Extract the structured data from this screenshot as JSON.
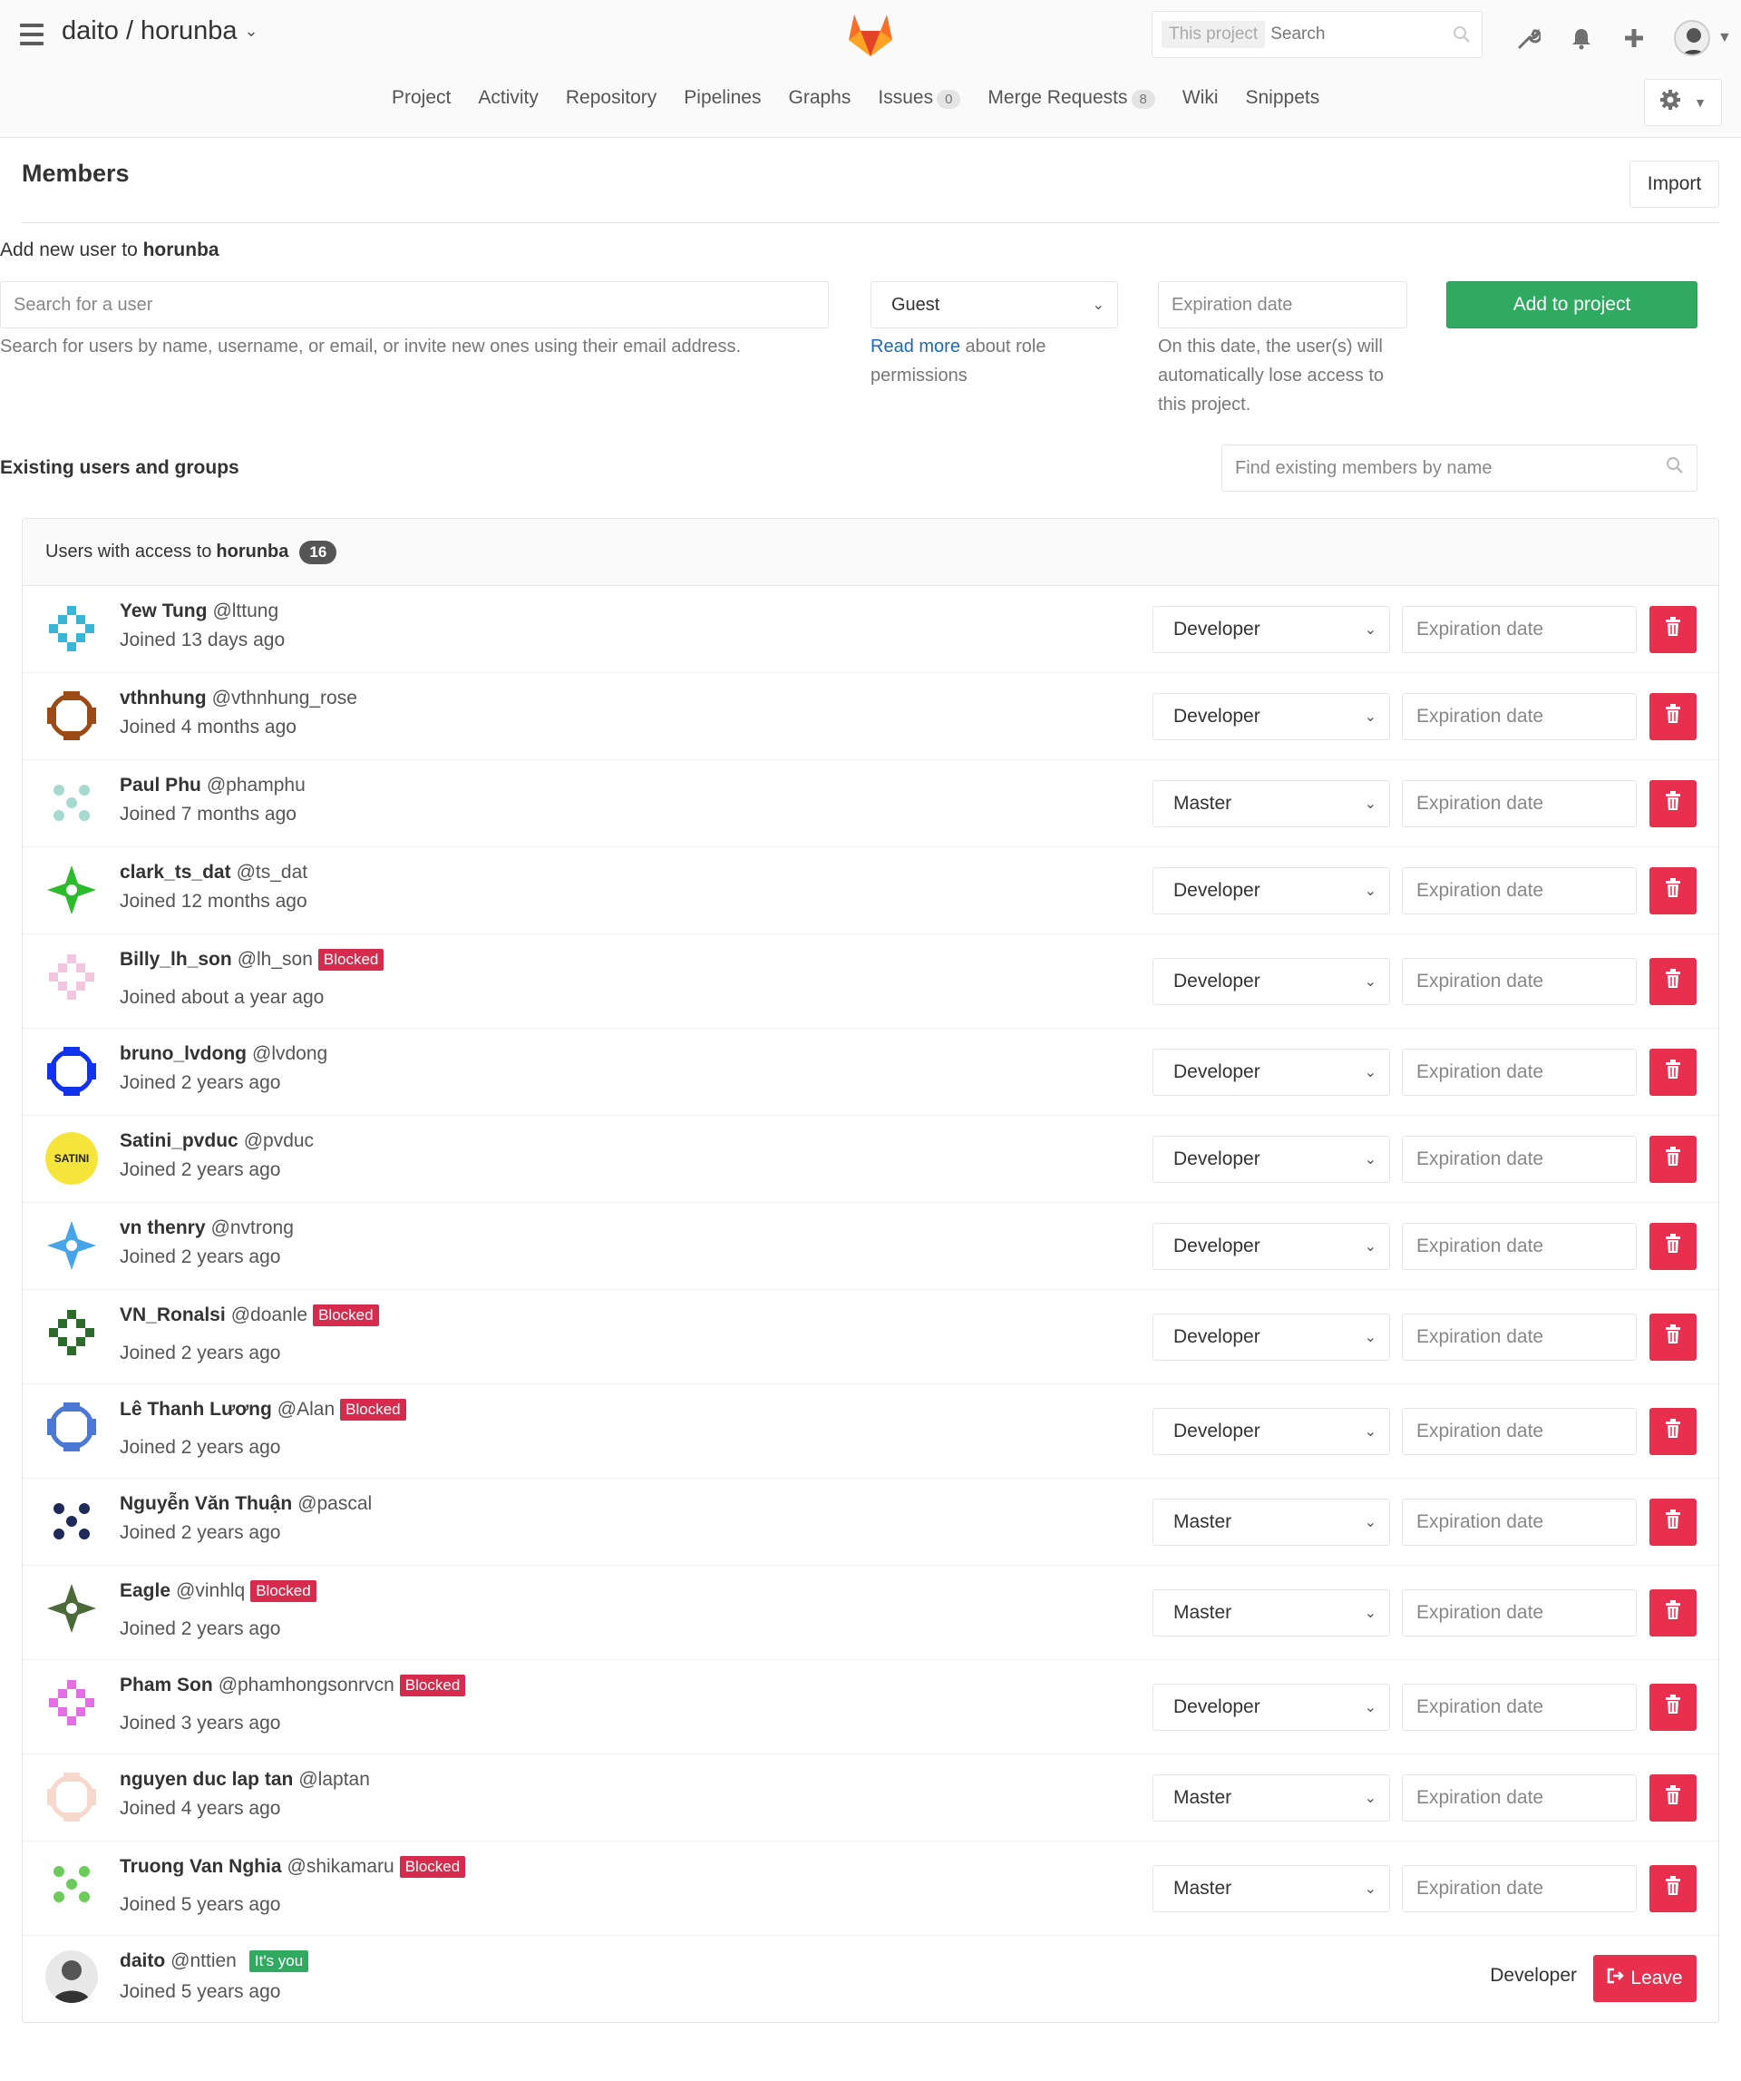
{
  "header": {
    "project_path": "daito / horunba",
    "search_scope": "This project",
    "search_placeholder": "Search",
    "nav": [
      {
        "label": "Project"
      },
      {
        "label": "Activity"
      },
      {
        "label": "Repository"
      },
      {
        "label": "Pipelines"
      },
      {
        "label": "Graphs"
      },
      {
        "label": "Issues",
        "count": "0"
      },
      {
        "label": "Merge Requests",
        "count": "8"
      },
      {
        "label": "Wiki"
      },
      {
        "label": "Snippets"
      }
    ]
  },
  "page": {
    "title": "Members",
    "import_label": "Import"
  },
  "add_user": {
    "label_prefix": "Add new user to",
    "project": "horunba",
    "search_placeholder": "Search for a user",
    "search_help": "Search for users by name, username, or email, or invite new ones using their email address.",
    "role_selected": "Guest",
    "role_help_link": "Read more",
    "role_help_line1": " about role",
    "role_help_line2": "permissions",
    "expiration_placeholder": "Expiration date",
    "expiration_help_1": "On this date, the user(s) will",
    "expiration_help_2": "automatically lose access to",
    "expiration_help_3": "this project.",
    "add_button": "Add to project"
  },
  "existing": {
    "label": "Existing users and groups",
    "find_placeholder": "Find existing members by name"
  },
  "panel": {
    "prefix": "Users with access to",
    "project": "horunba",
    "count": "16"
  },
  "members": [
    {
      "name": "Yew Tung",
      "handle": "@lttung",
      "joined": "Joined 13 days ago",
      "role": "Developer",
      "blocked": false,
      "color": "#38b6d6"
    },
    {
      "name": "vthnhung",
      "handle": "@vthnhung_rose",
      "joined": "Joined 4 months ago",
      "role": "Developer",
      "blocked": false,
      "color": "#9c4a16"
    },
    {
      "name": "Paul Phu",
      "handle": "@phamphu",
      "joined": "Joined 7 months ago",
      "role": "Master",
      "blocked": false,
      "color": "#a6dad0"
    },
    {
      "name": "clark_ts_dat",
      "handle": "@ts_dat",
      "joined": "Joined 12 months ago",
      "role": "Developer",
      "blocked": false,
      "color": "#2bbb2b"
    },
    {
      "name": "Billy_lh_son",
      "handle": "@lh_son",
      "joined": "Joined about a year ago",
      "role": "Developer",
      "blocked": true,
      "color": "#f3c6df"
    },
    {
      "name": "bruno_lvdong",
      "handle": "@lvdong",
      "joined": "Joined 2 years ago",
      "role": "Developer",
      "blocked": false,
      "color": "#1133ee"
    },
    {
      "name": "Satini_pvduc",
      "handle": "@pvduc",
      "joined": "Joined 2 years ago",
      "role": "Developer",
      "blocked": false,
      "color": "#f5e43a"
    },
    {
      "name": "vn thenry",
      "handle": "@nvtrong",
      "joined": "Joined 2 years ago",
      "role": "Developer",
      "blocked": false,
      "color": "#47a4e8"
    },
    {
      "name": "VN_Ronalsi",
      "handle": "@doanle",
      "joined": "Joined 2 years ago",
      "role": "Developer",
      "blocked": true,
      "color": "#2d6b2d"
    },
    {
      "name": "Lê Thanh Lương",
      "handle": "@Alan",
      "joined": "Joined 2 years ago",
      "role": "Developer",
      "blocked": true,
      "color": "#4a78d4"
    },
    {
      "name": "Nguyễn Văn Thuận",
      "handle": "@pascal",
      "joined": "Joined 2 years ago",
      "role": "Master",
      "blocked": false,
      "color": "#1e2a5a"
    },
    {
      "name": "Eagle",
      "handle": "@vinhlq",
      "joined": "Joined 2 years ago",
      "role": "Master",
      "blocked": true,
      "color": "#4a6a3a"
    },
    {
      "name": "Pham Son",
      "handle": "@phamhongsonrvcn",
      "joined": "Joined 3 years ago",
      "role": "Developer",
      "blocked": true,
      "color": "#e46ee4"
    },
    {
      "name": "nguyen duc lap tan",
      "handle": "@laptan",
      "joined": "Joined 4 years ago",
      "role": "Master",
      "blocked": false,
      "color": "#f7d8cc"
    },
    {
      "name": "Truong Van Nghia",
      "handle": "@shikamaru",
      "joined": "Joined 5 years ago",
      "role": "Master",
      "blocked": true,
      "color": "#6ccb5a"
    }
  ],
  "self": {
    "name": "daito",
    "handle": "@nttien",
    "tag": "It's you",
    "joined": "Joined 5 years ago",
    "role": "Developer",
    "leave_label": "Leave"
  },
  "labels": {
    "blocked": "Blocked",
    "expiration_placeholder": "Expiration date",
    "satini_text": "SATINI"
  }
}
